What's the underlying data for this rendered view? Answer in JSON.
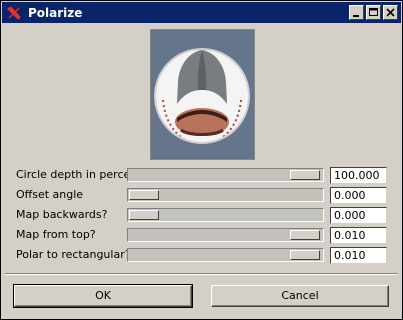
{
  "window": {
    "title": "Polarize",
    "icon": "x-app-icon",
    "controls": [
      "minimize-icon",
      "maximize-icon",
      "close-icon"
    ]
  },
  "parameters": [
    {
      "label": "Circle depth in percent",
      "value": "100.000",
      "slider_fraction": 0.88
    },
    {
      "label": "Offset angle",
      "value": "0.000",
      "slider_fraction": 0.0
    },
    {
      "label": "Map backwards?",
      "value": "0.000",
      "slider_fraction": 0.0
    },
    {
      "label": "Map from top?",
      "value": "0.010",
      "slider_fraction": 0.88
    },
    {
      "label": "Polar to rectangular?",
      "value": "0.010",
      "slider_fraction": 0.88
    }
  ],
  "buttons": {
    "ok": "OK",
    "cancel": "Cancel"
  },
  "colors": {
    "titlebar": "#0a246a",
    "face": "#d4d0c8"
  }
}
